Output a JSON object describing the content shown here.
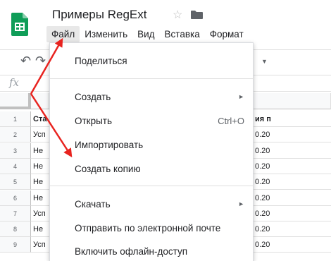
{
  "doc": {
    "title": "Примеры RegExt",
    "star_icon": "star-outline-icon",
    "folder_icon": "folder-icon"
  },
  "menubar": {
    "items": [
      "Файл",
      "Изменить",
      "Вид",
      "Вставка",
      "Формат"
    ],
    "active_index": 0
  },
  "toolbar": {
    "undo_icon": "undo-icon",
    "redo_icon": "redo-icon",
    "fx_label": "fx"
  },
  "grid": {
    "rows": [
      {
        "num": "1",
        "a": "Ста",
        "c": "ия п"
      },
      {
        "num": "2",
        "a": "Усп",
        "c": "0.20"
      },
      {
        "num": "3",
        "a": "Не",
        "c": "0.20"
      },
      {
        "num": "4",
        "a": "Не",
        "c": "0.20"
      },
      {
        "num": "5",
        "a": "Не",
        "c": "0.20"
      },
      {
        "num": "6",
        "a": "Не",
        "c": "0.20"
      },
      {
        "num": "7",
        "a": "Усп",
        "c": "0.20"
      },
      {
        "num": "8",
        "a": "Не",
        "c": "0.20"
      },
      {
        "num": "9",
        "a": "Усп",
        "c": "0.20"
      }
    ]
  },
  "file_menu": {
    "items": [
      {
        "label": "Поделиться",
        "shortcut": "",
        "submenu": false
      },
      {
        "label": "Создать",
        "shortcut": "",
        "submenu": true
      },
      {
        "label": "Открыть",
        "shortcut": "Ctrl+O",
        "submenu": false
      },
      {
        "label": "Импортировать",
        "shortcut": "",
        "submenu": false
      },
      {
        "label": "Создать копию",
        "shortcut": "",
        "submenu": false
      },
      {
        "label": "Скачать",
        "shortcut": "",
        "submenu": true
      },
      {
        "label": "Отправить по электронной почте",
        "shortcut": "",
        "submenu": false
      },
      {
        "label": "Включить офлайн-доступ",
        "shortcut": "",
        "submenu": false
      }
    ]
  },
  "colors": {
    "sheets_green": "#0f9d58",
    "annotation_red": "#e8231f",
    "menu_active_bg": "#e8e8e8"
  }
}
